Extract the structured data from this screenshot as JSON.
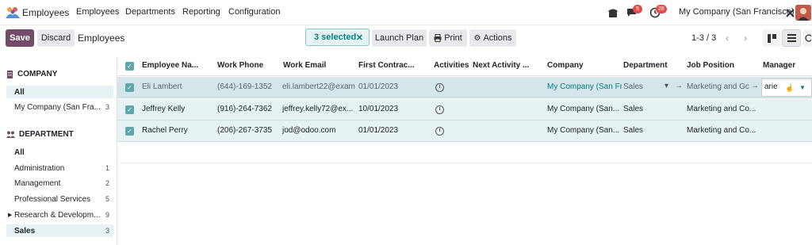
{
  "navbar": {
    "app_name": "Employees",
    "menu": [
      "Employees",
      "Departments",
      "Reporting",
      "Configuration"
    ],
    "chat_badge": "5",
    "activity_badge": "28",
    "company": "My Company (San Francisco)"
  },
  "control_panel": {
    "save": "Save",
    "discard": "Discard",
    "breadcrumb": "Employees",
    "selected": "3 selected",
    "launch_plan": "Launch Plan",
    "print": "Print",
    "actions": "Actions",
    "pager": "1-3 / 3"
  },
  "sidebar": {
    "company_title": "COMPANY",
    "company_items": [
      {
        "label": "All",
        "count": ""
      },
      {
        "label": "My Company (San Fra...",
        "count": "3"
      }
    ],
    "department_title": "DEPARTMENT",
    "department_items": [
      {
        "label": "All",
        "count": ""
      },
      {
        "label": "Administration",
        "count": "1"
      },
      {
        "label": "Management",
        "count": "2"
      },
      {
        "label": "Professional Services",
        "count": "5"
      },
      {
        "label": "Research & Developm...",
        "count": "9"
      },
      {
        "label": "Sales",
        "count": "3"
      }
    ]
  },
  "table": {
    "headers": [
      "Employee Na...",
      "Work Phone",
      "Work Email",
      "First Contrac...",
      "Activities",
      "Next Activity ...",
      "Company",
      "Department",
      "Job Position",
      "Manager"
    ],
    "rows": [
      {
        "name": "Eli Lambert",
        "phone": "(644)-169-1352",
        "email": "eli.lambert22@exam",
        "contract": "01/01/2023",
        "company": "My Company (San Fr",
        "department": "Sales",
        "job": "Marketing and Gc",
        "manager": "arie"
      },
      {
        "name": "Jeffrey Kelly",
        "phone": "(916)-264-7362",
        "email": "jeffrey.kelly72@ex...",
        "contract": "10/01/2023",
        "company": "My Company (San...",
        "department": "Sales",
        "job": "Marketing and Co...",
        "manager": ""
      },
      {
        "name": "Rachel Perry",
        "phone": "(206)-267-3735",
        "email": "jod@odoo.com",
        "contract": "01/01/2023",
        "company": "My Company (San...",
        "department": "Sales",
        "job": "Marketing and Co...",
        "manager": ""
      }
    ]
  },
  "icons": {
    "app": "employees-app-icon",
    "phone": "phone-icon",
    "chat": "chat-icon",
    "activity": "clock-icon",
    "debug": "tools-icon",
    "close": "close-icon",
    "printer": "printer-icon",
    "gear": "gear-icon",
    "kanban": "kanban-view-icon",
    "list": "list-view-icon"
  },
  "colors": {
    "primary": "#714b67",
    "teal": "#017e84",
    "selected_row": "#e6f2f3",
    "badge": "#e44c4c"
  }
}
